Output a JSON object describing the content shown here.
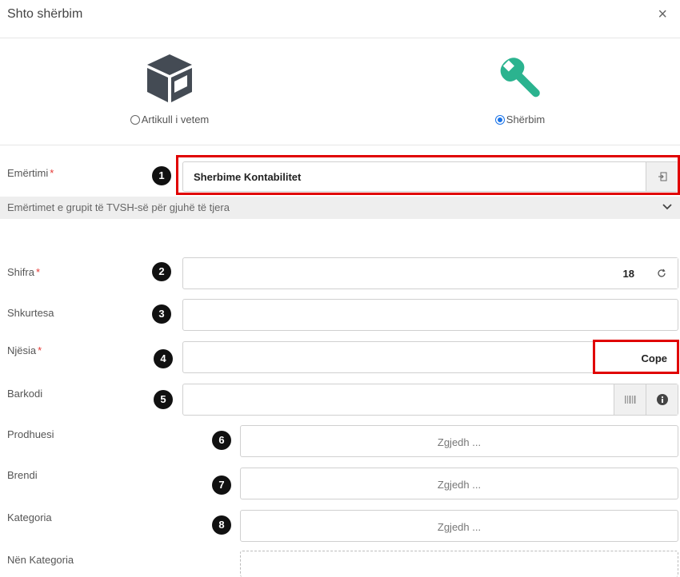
{
  "dialog": {
    "title": "Shto shërbim",
    "close_label": "×"
  },
  "type_options": [
    {
      "label": "Artikull i vetem",
      "checked": false,
      "icon": "box-icon"
    },
    {
      "label": "Shërbim",
      "checked": true,
      "icon": "wrench-icon"
    }
  ],
  "fields": {
    "emertimi": {
      "label": "Emërtimi",
      "required": "*",
      "value": "Sherbime Kontabilitet",
      "badge": "1"
    },
    "group_names": {
      "label": "Emërtimet e grupit të TVSH-së për gjuhë të tjera"
    },
    "shifra": {
      "label": "Shifra",
      "required": "*",
      "value": "18",
      "badge": "2"
    },
    "shkurtesa": {
      "label": "Shkurtesa",
      "value": "",
      "badge": "3"
    },
    "njesia": {
      "label": "Njësia",
      "required": "*",
      "value": "Cope",
      "badge": "4"
    },
    "barkodi": {
      "label": "Barkodi",
      "value": "",
      "badge": "5"
    },
    "prodhuesi": {
      "label": "Prodhuesi",
      "placeholder": "Zgjedh ...",
      "badge": "6"
    },
    "brendi": {
      "label": "Brendi",
      "placeholder": "Zgjedh ...",
      "badge": "7"
    },
    "kategoria": {
      "label": "Kategoria",
      "placeholder": "Zgjedh ...",
      "badge": "8"
    },
    "nen_kategoria": {
      "label": "Nën Kategoria"
    }
  },
  "colors": {
    "accent": "#1a73e8",
    "wrench": "#2bb38f",
    "box": "#444b54",
    "highlight": "#e00000"
  }
}
